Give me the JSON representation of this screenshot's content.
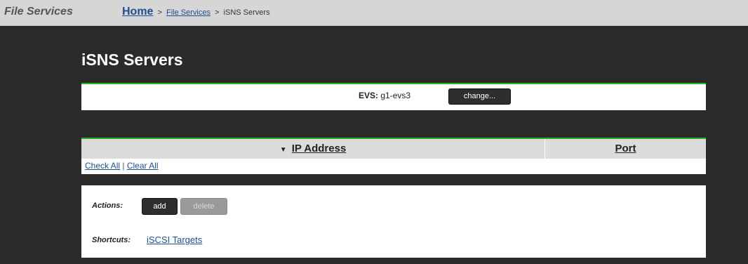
{
  "header": {
    "app_title": "File Services",
    "breadcrumb": {
      "home": "Home",
      "separator": ">",
      "file_services": "File Services",
      "current": "iSNS Servers"
    }
  },
  "page": {
    "title": "iSNS Servers"
  },
  "evs": {
    "label": "EVS:",
    "value": "g1-evs3",
    "change_button": "change..."
  },
  "table": {
    "sort_icon": "sort-descending-icon",
    "columns": [
      "IP Address",
      "Port"
    ],
    "rows": [],
    "check_all": "Check All",
    "divider": "|",
    "clear_all": "Clear All"
  },
  "actions": {
    "label": "Actions:",
    "add": "add",
    "delete": "delete",
    "delete_enabled": false
  },
  "shortcuts": {
    "label": "Shortcuts:",
    "links": [
      "iSCSI Targets"
    ]
  },
  "colors": {
    "accent_green": "#2db52d",
    "link_blue": "#1f4f8f",
    "background": "#2a2a2a"
  }
}
